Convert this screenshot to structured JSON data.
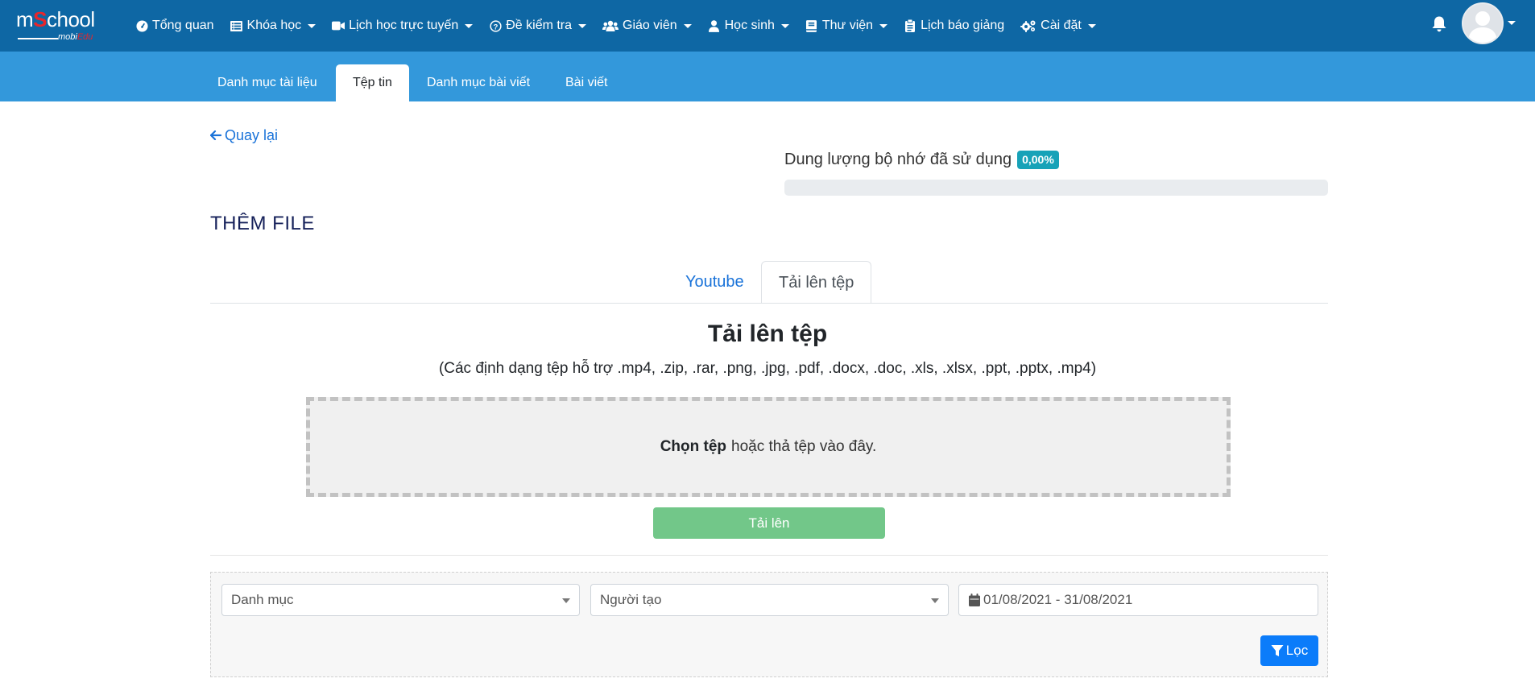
{
  "brand": {
    "logo_main_prefix": "m",
    "logo_main_s": "S",
    "logo_main_suffix": "chool",
    "logo_sub_prefix": "mobi",
    "logo_sub_suffix": "Edu"
  },
  "nav": {
    "items": [
      {
        "label": "Tổng quan",
        "icon": "dashboard-icon",
        "dropdown": false
      },
      {
        "label": "Khóa học",
        "icon": "list-icon",
        "dropdown": true
      },
      {
        "label": "Lịch học trực tuyến",
        "icon": "video-icon",
        "dropdown": true
      },
      {
        "label": "Đề kiểm tra",
        "icon": "question-circle-icon",
        "dropdown": true
      },
      {
        "label": "Giáo viên",
        "icon": "users-icon",
        "dropdown": true
      },
      {
        "label": "Học sinh",
        "icon": "user-icon",
        "dropdown": true
      },
      {
        "label": "Thư viện",
        "icon": "book-icon",
        "dropdown": true
      },
      {
        "label": "Lịch báo giảng",
        "icon": "clipboard-icon",
        "dropdown": false
      },
      {
        "label": "Cài đặt",
        "icon": "gears-icon",
        "dropdown": true
      }
    ]
  },
  "subnav": {
    "tabs": [
      {
        "label": "Danh mục tài liệu",
        "active": false
      },
      {
        "label": "Tệp tin",
        "active": true
      },
      {
        "label": "Danh mục bài viết",
        "active": false
      },
      {
        "label": "Bài viết",
        "active": false
      }
    ]
  },
  "back_label": "Quay lại",
  "storage": {
    "label": "Dung lượng bộ nhớ đã sử dụng",
    "value": "0,00%",
    "fraction": 0.0
  },
  "page_title": "THÊM FILE",
  "tabs": {
    "youtube": "Youtube",
    "upload": "Tải lên tệp"
  },
  "upload": {
    "title": "Tải lên tệp",
    "formats": "(Các định dạng tệp hỗ trợ .mp4, .zip, .rar, .png, .jpg, .pdf, .docx, .doc, .xls, .xlsx, .ppt, .pptx, .mp4)",
    "choose": "Chọn tệp",
    "drop_text": "hoặc thả tệp vào đây.",
    "button": "Tải lên"
  },
  "filter": {
    "category_placeholder": "Danh mục",
    "creator_placeholder": "Người tạo",
    "date_range": "01/08/2021 - 31/08/2021",
    "button": "Lọc"
  },
  "colors": {
    "topbar": "#0e67a4",
    "subbar": "#3398db",
    "badge": "#17a2b8",
    "upload_button": "#72c789",
    "filter_button": "#0b7cfa",
    "link": "#1a73d9"
  }
}
